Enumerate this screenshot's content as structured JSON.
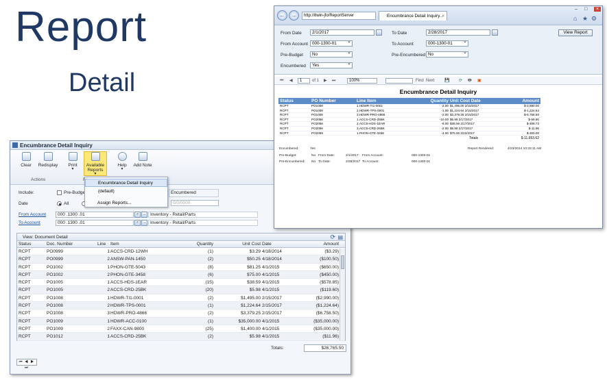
{
  "slide": {
    "title": "Report",
    "subtitle": "Detail"
  },
  "app": {
    "title": "Encumbrance Detail Inquiry",
    "ribbon": {
      "clear": "Clear",
      "redisplay": "Redisplay",
      "print": "Print",
      "available_reports_1": "Available",
      "available_reports_2": "Reports",
      "help": "Help",
      "add_note": "Add Note",
      "group_actions": "Actions",
      "group_f": "F"
    },
    "menu": {
      "item1": "Encumbrance Detail Inquiry (default)",
      "separator": "-",
      "item2": "Assign Reports..."
    },
    "filters": {
      "include_label": "Include:",
      "pre_budget": "Pre-Budget",
      "encumbered": "Encumbered",
      "date_label": "Date",
      "all": "All",
      "date_placeholder": "0/0/0000",
      "from_account_label": "From Account",
      "to_account_label": "To Account",
      "from_account_value": "000 .1300 .01",
      "to_account_value": "000 .1300 .01",
      "from_account_desc": "Inventory - Retail/Parts",
      "to_account_desc": "Inventory - Retail/Parts"
    },
    "grid": {
      "view_label": "View: Document Detail",
      "headers": [
        "Status",
        "Doc. Number",
        "Line",
        "Item",
        "Quantity",
        "Unit Cost",
        "Date",
        "Amount"
      ],
      "rows": [
        [
          "RCPT",
          "PO0999",
          "1",
          "ACCS-CRD-12WH",
          "(1)",
          "$3.29",
          "4/18/2014",
          "($3.29)"
        ],
        [
          "RCPT",
          "PO0999",
          "2",
          "ANSW-PAN-1450",
          "(2)",
          "$50.25",
          "4/18/2014",
          "($100.50)"
        ],
        [
          "RCPT",
          "PO1002",
          "1",
          "PHON-GTE-5043",
          "(8)",
          "$81.25",
          "4/1/2015",
          "($650.00)"
        ],
        [
          "RCPT",
          "PO1002",
          "2",
          "PHON-GTE-3458",
          "(6)",
          "$75.00",
          "4/1/2015",
          "($450.00)"
        ],
        [
          "RCPT",
          "PO1005",
          "1",
          "ACCS-HDS-1EAR",
          "(15)",
          "$38.59",
          "4/1/2015",
          "($578.85)"
        ],
        [
          "RCPT",
          "PO1005",
          "2",
          "ACCS-CRD-25BK",
          "(20)",
          "$5.98",
          "4/1/2015",
          "($119.60)"
        ],
        [
          "RCPT",
          "PO1008",
          "1",
          "HDWR-TI1-0001",
          "(2)",
          "$1,495.00",
          "2/15/2017",
          "($2,990.00)"
        ],
        [
          "RCPT",
          "PO1008",
          "2",
          "HDWR-TPS-0001",
          "(1)",
          "$1,224.64",
          "2/15/2017",
          "($1,224.64)"
        ],
        [
          "RCPT",
          "PO1008",
          "3",
          "HDWR-PRO-4866",
          "(2)",
          "$3,379.25",
          "2/15/2017",
          "($6,758.50)"
        ],
        [
          "RCPT",
          "PO1009",
          "1",
          "HDWR-ACC-0100",
          "(1)",
          "$35,000.00",
          "4/1/2015",
          "($35,000.00)"
        ],
        [
          "RCPT",
          "PO1009",
          "2",
          "FAXX-CAN-9800",
          "(25)",
          "$1,400.00",
          "4/1/2015",
          "($35,000.00)"
        ],
        [
          "RCPT",
          "PO1012",
          "1",
          "ACCS-CRD-25BK",
          "(2)",
          "$5.98",
          "4/1/2015",
          "($11.96)"
        ]
      ],
      "totals_label": "Totals:",
      "totals_value": "$26,765.50",
      "pager": "⏮ ◀ ▶ ⏭"
    }
  },
  "browser": {
    "address": "http://8win-jfo/ReportServer",
    "tab_title": "Encumbrance Detail Inquiry...",
    "params": {
      "from_date_label": "From Date",
      "from_date": "2/1/2017",
      "to_date_label": "To Date",
      "to_date": "2/28/2017",
      "from_account_label": "From Account",
      "from_account": "000-1300-01",
      "to_account_label": "To Account",
      "to_account": "000-1300-01",
      "pre_budget_label": "Pre-Budget",
      "pre_budget": "No",
      "pre_encumbered_label": "Pre-Encumbered",
      "pre_encumbered": "No",
      "encumbered_label": "Encumbered",
      "encumbered": "Yes",
      "view_report": "View Report"
    },
    "toolbar": {
      "page": "1",
      "of": "of 1",
      "zoom": "100%",
      "find": "Find",
      "next": "Next"
    },
    "report": {
      "title": "Encumbrance Detail Inquiry",
      "headers": [
        "Status",
        "PO Number",
        "Line Item",
        "Quantity",
        "Unit Cost Date",
        "Amount"
      ],
      "rows": [
        [
          "RCPT",
          "PO1008",
          "1.HDWR-TI1-0001",
          "-2.00",
          "$1,495.00 2/15/2017",
          "$-2,990.00"
        ],
        [
          "RCPT",
          "PO1008",
          "2.HDWR-TPS-0001",
          "-1.00",
          "$1,224.64 2/15/2017",
          "$-1,224.64"
        ],
        [
          "RCPT",
          "PO1008",
          "3.HDWR-PRO-4866",
          "-2.00",
          "$3,379.25 2/15/2017",
          "$-6,758.50"
        ],
        [
          "RCPT",
          "PO2056",
          "1.ACCS-CRD-25BK",
          "-10.00",
          "$5.98 2/17/2017",
          "$-59.80"
        ],
        [
          "RCPT",
          "PO2056",
          "2.ACCS-HDS-1EAR",
          "-8.00",
          "$38.59 2/17/2017",
          "$-308.72"
        ],
        [
          "RCPT",
          "PO2056",
          "3.ACCS-CRD-25BK",
          "-2.00",
          "$5.98 2/17/2017",
          "$-11.96"
        ],
        [
          "RCPT",
          "PO2059",
          "1.PHON-GTE-3458",
          "-4.00",
          "$75.00 2/22/2017",
          "$-300.00"
        ]
      ],
      "totals_label": "Totals",
      "totals_value": "$-11,653.62",
      "footer": {
        "encumbered_label": "Encumbered:",
        "encumbered": "Yes",
        "rendered_label": "Report Rendered:",
        "rendered": "4/23/2014 10:33:11 AM",
        "pre_budget_label": "Pre-Budget:",
        "pre_budget": "No",
        "from_date_label": "From Date:",
        "from_date": "2/1/2017",
        "from_account_label": "From Account:",
        "from_account": "000-1300-01",
        "pre_encumbered_label": "Pre-Encumbered:",
        "pre_encumbered": "No",
        "to_date_label": "To Date:",
        "to_date": "2/28/2017",
        "to_account_label": "To Account:",
        "to_account": "000-1300-01"
      }
    }
  },
  "colors": {
    "title": "#1f3864",
    "report_header": "#5b8cc8",
    "ribbon_active": "#ffe87a"
  }
}
